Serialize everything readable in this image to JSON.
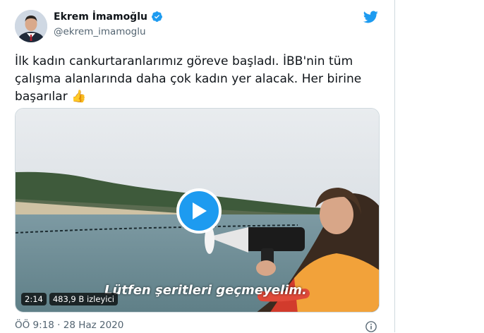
{
  "tweet": {
    "display_name": "Ekrem İmamoğlu",
    "handle": "@ekrem_imamoglu",
    "text": "İlk kadın cankurtaranlarımız göreve başladı. İBB'nin tüm çalışma alanlarında daha çok kadın yer alacak. Her birine başarılar",
    "emoji": "👍",
    "timestamp": "ÖÖ 9:18 · 28 Haz 2020"
  },
  "video": {
    "subtitle": "Lütfen şeritleri geçmeyelim.",
    "duration": "2:14",
    "views": "483,9 B izleyici"
  },
  "icons": {
    "verified": "verified-badge-icon",
    "brand": "twitter-bird-icon",
    "play": "play-icon",
    "info": "info-icon"
  },
  "colors": {
    "accent": "#1d9bf0",
    "text": "#0f1419",
    "muted": "#536471"
  }
}
